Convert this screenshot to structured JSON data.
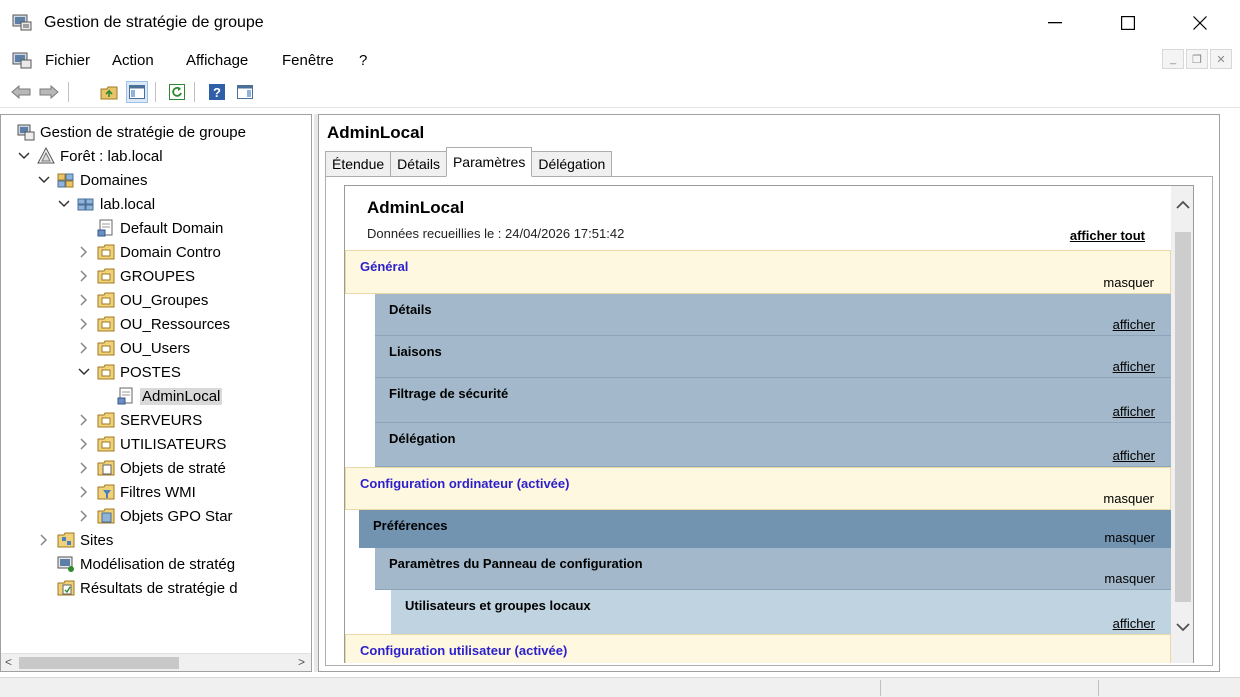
{
  "window": {
    "title": "Gestion de stratégie de groupe",
    "min_glyph": "—",
    "max_glyph": "☐",
    "close_glyph": "✕"
  },
  "menu": {
    "items": [
      "Fichier",
      "Action",
      "Affichage",
      "Fenêtre",
      "?"
    ],
    "mdi_min": "_",
    "mdi_restore": "❐",
    "mdi_close": "✕"
  },
  "toolbar": {
    "icons": [
      "back-arrow-icon",
      "forward-arrow-icon",
      "up-folder-icon",
      "show-hide-console-tree-icon",
      "refresh-icon",
      "help-icon",
      "show-action-pane-icon"
    ]
  },
  "tree": {
    "items": [
      {
        "label": "Gestion de stratégie de groupe",
        "level": 0,
        "expander": "",
        "icon": "gpmc-icon"
      },
      {
        "label": "Forêt : lab.local",
        "level": 0,
        "expander": "open",
        "icon": "forest-icon"
      },
      {
        "label": "Domaines",
        "level": 1,
        "expander": "open",
        "icon": "domains-icon"
      },
      {
        "label": "lab.local",
        "level": 2,
        "expander": "open",
        "icon": "domain-icon"
      },
      {
        "label": "Default Domain",
        "level": 3,
        "expander": "",
        "icon": "gpo-link-icon"
      },
      {
        "label": "Domain Contro",
        "level": 3,
        "expander": "closed",
        "icon": "ou-icon"
      },
      {
        "label": "GROUPES",
        "level": 3,
        "expander": "closed",
        "icon": "ou-icon"
      },
      {
        "label": "OU_Groupes",
        "level": 3,
        "expander": "closed",
        "icon": "ou-icon"
      },
      {
        "label": "OU_Ressources",
        "level": 3,
        "expander": "closed",
        "icon": "ou-icon"
      },
      {
        "label": "OU_Users",
        "level": 3,
        "expander": "closed",
        "icon": "ou-icon"
      },
      {
        "label": "POSTES",
        "level": 3,
        "expander": "open",
        "icon": "ou-icon"
      },
      {
        "label": "AdminLocal",
        "level": 4,
        "expander": "",
        "icon": "gpo-link-icon",
        "selected": true
      },
      {
        "label": "SERVEURS",
        "level": 3,
        "expander": "closed",
        "icon": "ou-icon"
      },
      {
        "label": "UTILISATEURS",
        "level": 3,
        "expander": "closed",
        "icon": "ou-icon"
      },
      {
        "label": "Objets de straté",
        "level": 3,
        "expander": "closed",
        "icon": "gpo-container-icon"
      },
      {
        "label": "Filtres WMI",
        "level": 3,
        "expander": "closed",
        "icon": "wmi-filter-icon"
      },
      {
        "label": "Objets GPO Star",
        "level": 3,
        "expander": "closed",
        "icon": "starter-gpo-icon"
      },
      {
        "label": "Sites",
        "level": 1,
        "expander": "closed",
        "icon": "sites-icon"
      },
      {
        "label": "Modélisation de stratég",
        "level": 1,
        "expander": "",
        "icon": "modeling-icon"
      },
      {
        "label": "Résultats de stratégie d",
        "level": 1,
        "expander": "",
        "icon": "results-icon"
      }
    ]
  },
  "details": {
    "title": "AdminLocal",
    "tabs": [
      {
        "label": "Étendue",
        "active": false
      },
      {
        "label": "Détails",
        "active": false
      },
      {
        "label": "Paramètres",
        "active": true
      },
      {
        "label": "Délégation",
        "active": false
      }
    ],
    "report": {
      "name": "AdminLocal",
      "collected": "Données recueillies le : 24/04/2026 17:51:42",
      "show_all": "afficher tout",
      "sections": [
        {
          "title": "Général",
          "action": "masquer",
          "style": "yellow"
        },
        {
          "title": "Détails",
          "action": "afficher",
          "style": "blue"
        },
        {
          "title": "Liaisons",
          "action": "afficher",
          "style": "blue"
        },
        {
          "title": "Filtrage de sécurité",
          "action": "afficher",
          "style": "blue"
        },
        {
          "title": "Délégation",
          "action": "afficher",
          "style": "blue"
        },
        {
          "title": "Configuration ordinateur (activée)",
          "action": "masquer",
          "style": "yellow"
        },
        {
          "title": "Préférences",
          "action": "masquer",
          "style": "dark"
        },
        {
          "title": "Paramètres du Panneau de configuration",
          "action": "masquer",
          "style": "blue"
        },
        {
          "title": "Utilisateurs et groupes locaux",
          "action": "afficher",
          "style": "light"
        },
        {
          "title": "Configuration utilisateur (activée)",
          "action": "",
          "style": "yellow"
        }
      ]
    }
  },
  "colors": {
    "yellow_section": "#fef8e0",
    "yellow_title": "#2b1fcc",
    "blue_section": "#a3b9cb",
    "dark_section": "#7294b0",
    "light_section": "#bfd3e1"
  }
}
